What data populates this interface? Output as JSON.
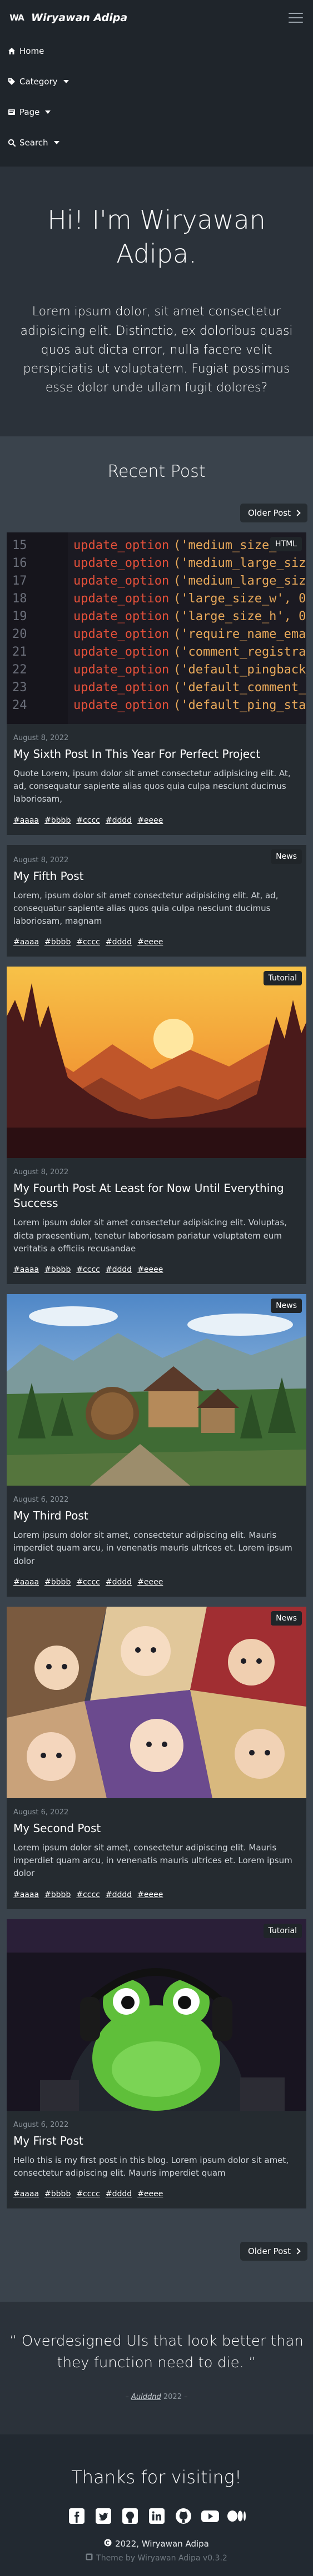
{
  "brand": {
    "logo": "WA",
    "name": "Wiryawan Adipa"
  },
  "nav": {
    "items": [
      {
        "label": "Home",
        "icon": "home-icon"
      },
      {
        "label": "Category",
        "icon": "tag-icon",
        "dropdown": true
      },
      {
        "label": "Page",
        "icon": "file-icon",
        "dropdown": true
      },
      {
        "label": "Search",
        "icon": "search-icon",
        "dropdown": true
      }
    ]
  },
  "hero": {
    "title": "Hi! I'm Wiryawan Adipa.",
    "text": "Lorem ipsum dolor, sit amet consectetur adipisicing elit. Distinctio, ex doloribus quasi quos aut dicta error, nulla facere velit perspiciatis ut voluptatem. Fugiat possimus esse dolor unde ullam fugit dolores?"
  },
  "recent": {
    "title": "Recent Post",
    "older_label": "Older Post",
    "posts": [
      {
        "badge": "HTML",
        "image": "code-editor-screenshot",
        "date": "August 8, 2022",
        "title": "My Sixth Post In This Year For Perfect Project",
        "text": "Quote Lorem, ipsum dolor sit amet consectetur adipisicing elit. At, ad, consequatur sapiente alias quos quia culpa nesciunt ducimus laboriosam,",
        "tags": [
          "#aaaa",
          "#bbbb",
          "#cccc",
          "#dddd",
          "#eeee"
        ]
      },
      {
        "badge": "News",
        "image": "",
        "date": "August 8, 2022",
        "title": "My Fifth Post",
        "text": "Lorem, ipsum dolor sit amet consectetur adipisicing elit. At, ad, consequatur sapiente alias quos quia culpa nesciunt ducimus laboriosam, magnam",
        "tags": [
          "#aaaa",
          "#bbbb",
          "#cccc",
          "#dddd",
          "#eeee"
        ]
      },
      {
        "badge": "Tutorial",
        "image": "sunset-forest-illustration",
        "date": "August 8, 2022",
        "title": "My Fourth Post At Least for Now Until Everything Success",
        "text": "Lorem ipsum dolor sit amet consectetur adipisicing elit. Voluptas, dicta praesentium, tenetur laboriosam pariatur voluptatem eum veritatis a officiis recusandae",
        "tags": [
          "#aaaa",
          "#bbbb",
          "#cccc",
          "#dddd",
          "#eeee"
        ]
      },
      {
        "badge": "News",
        "image": "fantasy-village-render",
        "date": "August 6, 2022",
        "title": "My Third Post",
        "text": "Lorem ipsum dolor sit amet, consectetur adipiscing elit. Mauris imperdiet quam arcu, in venenatis mauris ultrices et. Lorem ipsum dolor",
        "tags": [
          "#aaaa",
          "#bbbb",
          "#cccc",
          "#dddd",
          "#eeee"
        ]
      },
      {
        "badge": "News",
        "image": "anime-characters-collage",
        "date": "August 6, 2022",
        "title": "My Second Post",
        "text": "Lorem ipsum dolor sit amet, consectetur adipiscing elit. Mauris imperdiet quam arcu, in venenatis mauris ultrices et. Lorem ipsum dolor",
        "tags": [
          "#aaaa",
          "#bbbb",
          "#cccc",
          "#dddd",
          "#eeee"
        ]
      },
      {
        "badge": "Tutorial",
        "image": "frog-plush-with-headphones",
        "date": "August 6, 2022",
        "title": "My First Post",
        "text": "Hello this is my first post in this blog. Lorem ipsum dolor sit amet, consectetur adipiscing elit. Mauris imperdiet quam",
        "tags": [
          "#aaaa",
          "#bbbb",
          "#cccc",
          "#dddd",
          "#eeee"
        ]
      }
    ]
  },
  "quote": {
    "text": "Overdesigned UIs that look better than they function need to die.",
    "author": "Aulddnd",
    "year": "2022"
  },
  "footer": {
    "title": "Thanks for visiting!",
    "socials": [
      "facebook-icon",
      "twitter-icon",
      "github-icon",
      "linkedin-icon",
      "github-alt-icon",
      "youtube-icon",
      "medium-icon"
    ],
    "copyright": "2022, Wiryawan Adipa",
    "theme_by": "Theme by Wiryawan Adipa v0.3.2"
  },
  "colors": {
    "background": "#2b323a",
    "navbar": "#1f252b",
    "section": "#3a434c",
    "card": "#252b30",
    "footer": "#222931"
  }
}
